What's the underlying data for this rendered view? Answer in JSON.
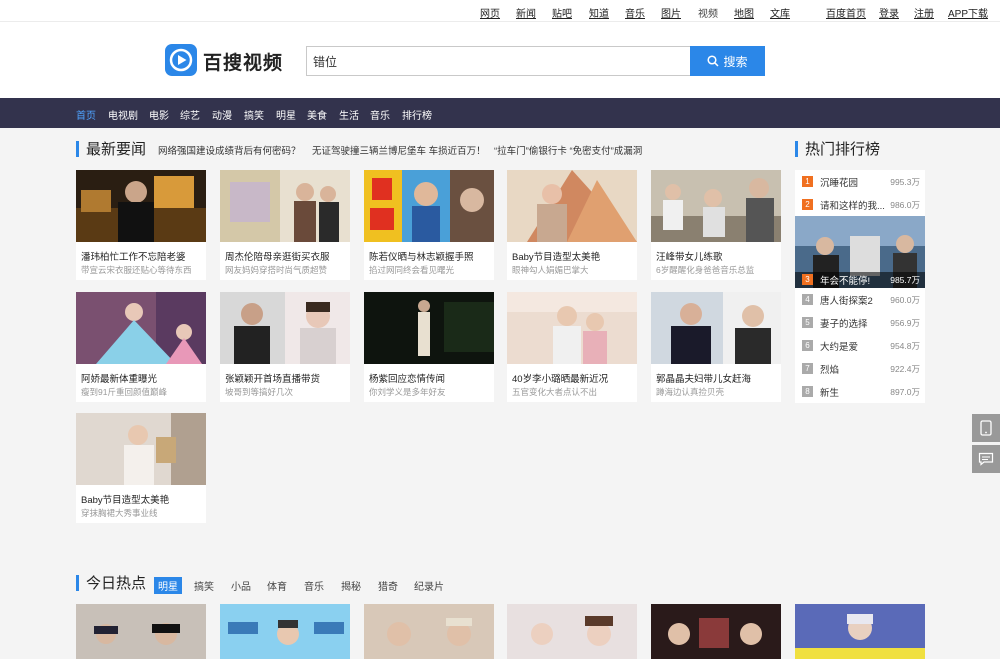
{
  "topnav": {
    "items": [
      "网页",
      "新闻",
      "贴吧",
      "知道",
      "音乐",
      "图片",
      "视频",
      "地图",
      "文库",
      "百度首页",
      "登录",
      "注册",
      "APP下载"
    ]
  },
  "header": {
    "logo_text": "百搜视频",
    "search_value": "错位",
    "search_button": "搜索"
  },
  "categories": [
    "首页",
    "电视剧",
    "电影",
    "综艺",
    "动漫",
    "搞笑",
    "明星",
    "美食",
    "生活",
    "音乐",
    "排行榜"
  ],
  "news": {
    "title": "最新要闻",
    "headlines": [
      "网络强国建设成绩背后有何密码？",
      "无证驾驶撞三辆兰博尼堡车 车损近百万！",
      "“拉车门”偷银行卡 “免密支付”成漏洞"
    ],
    "cards": [
      {
        "title": "潘玮柏忙工作不忘陪老婆",
        "sub": "带宣云宋衣服还贴心等待东西"
      },
      {
        "title": "周杰伦陪母亲逛街买衣服",
        "sub": "网友妈妈穿搭时尚气质超赞"
      },
      {
        "title": "陈若仪晒与林志颖握手照",
        "sub": "掐过网同终会看见曙光"
      },
      {
        "title": "Baby节目造型太美艳",
        "sub": "眼神勾人娟媚巴掌大"
      },
      {
        "title": "汪峰带女儿练歌",
        "sub": "6岁醒醒化身爸爸音乐总监"
      },
      {
        "title": "阿娇最新体重曝光",
        "sub": "瘦到91斤重回颜值巅峰"
      },
      {
        "title": "张颖颖开首场直播带货",
        "sub": "坡哥到等搞好几次"
      },
      {
        "title": "杨紫回应恋情传闻",
        "sub": "你刘学义是多年好友"
      },
      {
        "title": "40岁李小璐晒最新近况",
        "sub": "五官变化大者点认不出"
      },
      {
        "title": "郭晶晶夫妇带儿女赶海",
        "sub": "蹲海边认真捡贝壳"
      },
      {
        "title": "Baby节目造型太美艳",
        "sub": "穿抹胸裙大秀事业线"
      }
    ]
  },
  "ranking": {
    "title": "热门排行榜",
    "items": [
      {
        "num": "1",
        "title": "沉睡花园",
        "count": "995.3万"
      },
      {
        "num": "2",
        "title": "请和这样的我...",
        "count": "986.0万"
      },
      {
        "num": "3",
        "title": "年会不能停!",
        "count": "985.7万"
      },
      {
        "num": "4",
        "title": "唐人街探案2",
        "count": "960.0万"
      },
      {
        "num": "5",
        "title": "妻子的选择",
        "count": "956.9万"
      },
      {
        "num": "6",
        "title": "大约是爱",
        "count": "954.8万"
      },
      {
        "num": "7",
        "title": "烈焰",
        "count": "922.4万"
      },
      {
        "num": "8",
        "title": "新生",
        "count": "897.0万"
      }
    ]
  },
  "today_hot": {
    "title": "今日热点",
    "tabs": [
      "明星",
      "搞笑",
      "小品",
      "体育",
      "音乐",
      "揭秘",
      "猎奇",
      "纪录片"
    ]
  },
  "colors": {
    "accent": "#2b87e8",
    "catbar_bg": "#33334d",
    "rank_hot": "#f07020"
  }
}
